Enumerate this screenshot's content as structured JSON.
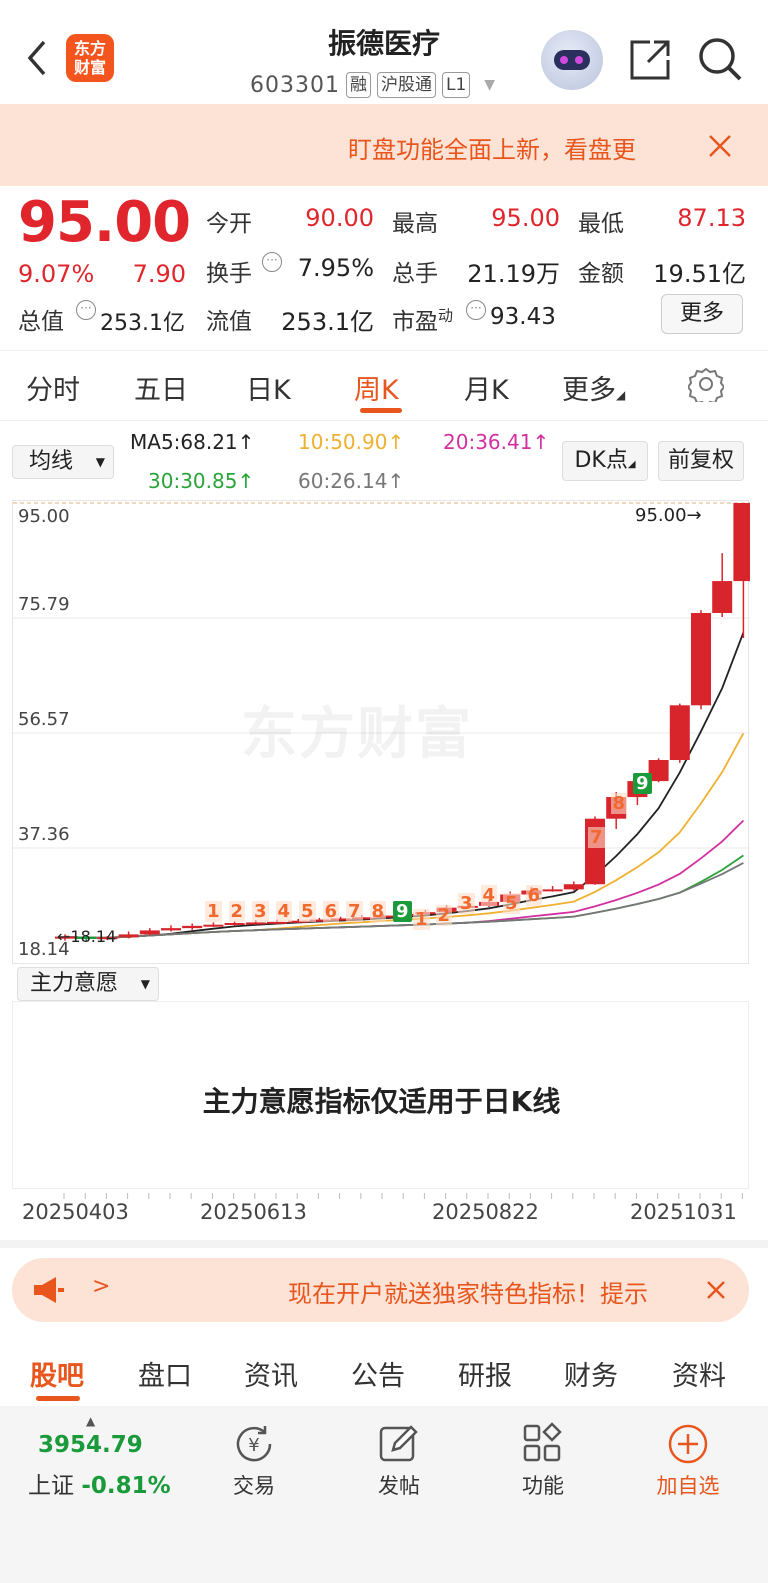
{
  "header": {
    "logo_text": "东方财富",
    "stock_name": "振德医疗",
    "stock_code": "603301",
    "tags": [
      "融",
      "沪股通",
      "L1"
    ]
  },
  "banner": {
    "text": "盯盘功能全面上新，看盘更"
  },
  "quote": {
    "price": "95.00",
    "change_pct": "9.07%",
    "change": "7.90",
    "open_label": "今开",
    "open": "90.00",
    "high_label": "最高",
    "high": "95.00",
    "low_label": "最低",
    "low": "87.13",
    "turnover_label": "换手",
    "turnover": "7.95%",
    "volume_label": "总手",
    "volume": "21.19万",
    "amount_label": "金额",
    "amount": "19.51亿",
    "mktcap_label": "总值",
    "mktcap": "253.1亿",
    "float_label": "流值",
    "float_cap": "253.1亿",
    "pe_label": "市盈",
    "pe_sup": "动",
    "pe": "93.43",
    "more": "更多"
  },
  "period_tabs": [
    "分时",
    "五日",
    "日K",
    "周K",
    "月K",
    "更多"
  ],
  "active_period": "周K",
  "ma_bar": {
    "selector": "均线",
    "ma5": "MA5:68.21↑",
    "ma10": "10:50.90↑",
    "ma20": "20:36.41↑",
    "ma30": "30:30.85↑",
    "ma60": "60:26.14↑",
    "dk_button": "DK点",
    "adjust_button": "前复权",
    "colors": {
      "ma5": "#222222",
      "ma10": "#f0b030",
      "ma20": "#d22fa0",
      "ma30": "#2aa43a",
      "ma60": "#777777"
    }
  },
  "chart": {
    "y_labels": [
      "95.00",
      "75.79",
      "56.57",
      "37.36",
      "18.14"
    ],
    "last_label": "95.00→",
    "low_label": "←18.14",
    "watermark": "东方财富",
    "seq_labels_1": [
      "1",
      "2",
      "3",
      "4",
      "5",
      "6",
      "7",
      "8",
      "9"
    ],
    "seq_labels_2": [
      "1",
      "2",
      "3",
      "4",
      "5",
      "6",
      "7",
      "8",
      "9"
    ],
    "x_labels": [
      "20250403",
      "20250613",
      "20250822",
      "20251031"
    ]
  },
  "chart_data": {
    "type": "candlestick",
    "ylim": [
      18.14,
      95.0
    ],
    "candles": [
      {
        "o": 18.6,
        "c": 18.9,
        "h": 19.3,
        "l": 18.2
      },
      {
        "o": 18.9,
        "c": 18.5,
        "h": 19.2,
        "l": 18.1
      },
      {
        "o": 18.5,
        "c": 18.8,
        "h": 19.0,
        "l": 18.3
      },
      {
        "o": 18.8,
        "c": 19.3,
        "h": 19.8,
        "l": 18.6
      },
      {
        "o": 19.3,
        "c": 20.0,
        "h": 20.4,
        "l": 19.1
      },
      {
        "o": 20.0,
        "c": 20.4,
        "h": 20.9,
        "l": 19.8
      },
      {
        "o": 20.4,
        "c": 20.8,
        "h": 21.2,
        "l": 20.1
      },
      {
        "o": 20.8,
        "c": 21.0,
        "h": 21.4,
        "l": 20.6
      },
      {
        "o": 21.0,
        "c": 21.3,
        "h": 21.6,
        "l": 20.8
      },
      {
        "o": 21.3,
        "c": 21.4,
        "h": 21.8,
        "l": 21.0
      },
      {
        "o": 21.4,
        "c": 21.5,
        "h": 21.9,
        "l": 21.1
      },
      {
        "o": 21.5,
        "c": 21.7,
        "h": 22.0,
        "l": 21.3
      },
      {
        "o": 21.7,
        "c": 21.9,
        "h": 22.2,
        "l": 21.5
      },
      {
        "o": 21.9,
        "c": 22.1,
        "h": 22.4,
        "l": 21.7
      },
      {
        "o": 22.1,
        "c": 22.3,
        "h": 22.7,
        "l": 21.9
      },
      {
        "o": 22.3,
        "c": 22.6,
        "h": 22.9,
        "l": 22.1
      },
      {
        "o": 22.6,
        "c": 22.9,
        "h": 23.2,
        "l": 22.4
      },
      {
        "o": 22.9,
        "c": 23.2,
        "h": 23.6,
        "l": 22.7
      },
      {
        "o": 23.2,
        "c": 24.0,
        "h": 24.4,
        "l": 23.0
      },
      {
        "o": 24.0,
        "c": 24.3,
        "h": 24.8,
        "l": 23.8
      },
      {
        "o": 24.3,
        "c": 25.0,
        "h": 25.4,
        "l": 24.1
      },
      {
        "o": 25.0,
        "c": 26.3,
        "h": 26.8,
        "l": 24.9
      },
      {
        "o": 26.3,
        "c": 27.0,
        "h": 27.6,
        "l": 26.0
      },
      {
        "o": 27.0,
        "c": 27.2,
        "h": 27.8,
        "l": 26.8
      },
      {
        "o": 27.2,
        "c": 28.1,
        "h": 28.6,
        "l": 27.0
      },
      {
        "o": 28.1,
        "c": 39.6,
        "h": 40.0,
        "l": 28.0
      },
      {
        "o": 39.6,
        "c": 43.4,
        "h": 44.3,
        "l": 37.8
      },
      {
        "o": 43.4,
        "c": 46.2,
        "h": 47.5,
        "l": 42.0
      },
      {
        "o": 46.2,
        "c": 49.9,
        "h": 50.2,
        "l": 46.0
      },
      {
        "o": 49.9,
        "c": 59.5,
        "h": 59.8,
        "l": 49.4
      },
      {
        "o": 59.5,
        "c": 75.7,
        "h": 76.2,
        "l": 58.8
      },
      {
        "o": 75.7,
        "c": 81.3,
        "h": 86.2,
        "l": 75.0
      },
      {
        "o": 81.3,
        "c": 95.0,
        "h": 95.0,
        "l": 71.3
      }
    ]
  },
  "indicator": {
    "selector": "主力意愿",
    "message": "主力意愿指标仅适用于日K线"
  },
  "ad": {
    "arrow": ">",
    "text": "现在开户就送独家特色指标！提示"
  },
  "bottom_tabs": [
    "股吧",
    "盘口",
    "资讯",
    "公告",
    "研报",
    "财务",
    "资料"
  ],
  "active_bottom_tab": "股吧",
  "toolbar": {
    "index_value": "3954.79",
    "index_name": "上证",
    "index_change": "-0.81%",
    "trade": "交易",
    "post": "发帖",
    "function": "功能",
    "add_watch": "加自选"
  }
}
